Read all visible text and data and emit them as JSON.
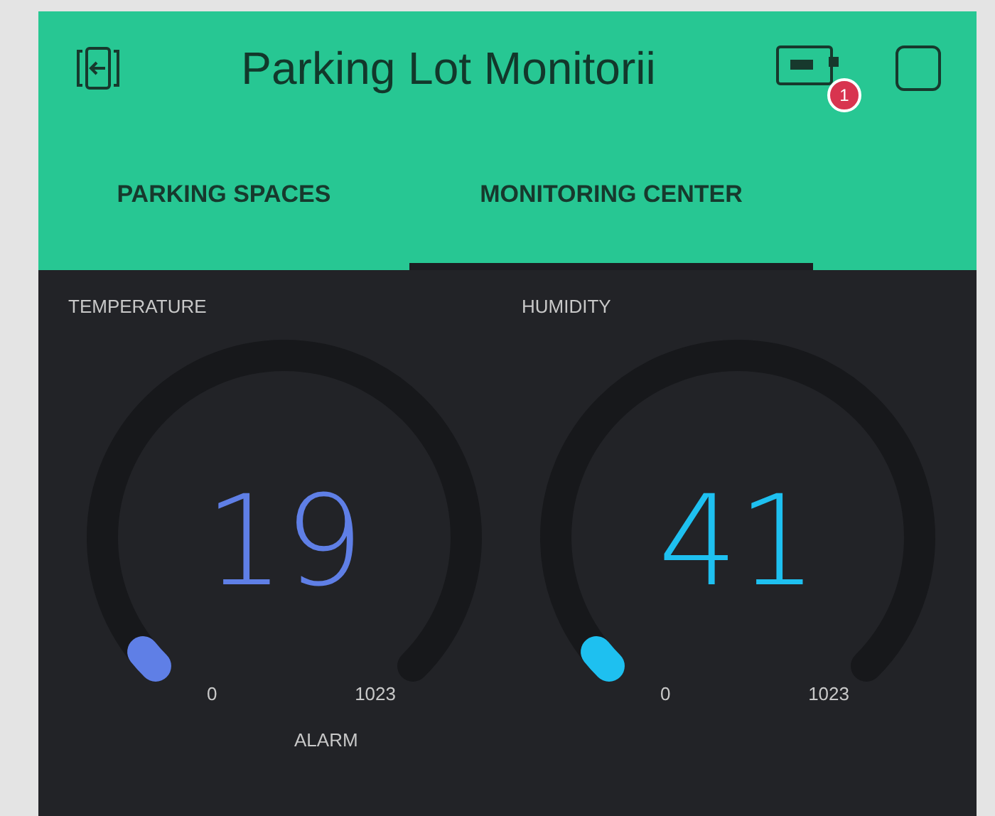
{
  "header": {
    "title": "Parking Lot Monitorii",
    "badge": "1"
  },
  "tabs": [
    {
      "label": "PARKING SPACES",
      "selected": false
    },
    {
      "label": "MONITORING CENTER",
      "selected": true
    }
  ],
  "gauges": [
    {
      "label": "TEMPERATURE",
      "value": "19",
      "min": "0",
      "max": "1023",
      "color": "#5f7fe6"
    },
    {
      "label": "HUMIDITY",
      "value": "41",
      "min": "0",
      "max": "1023",
      "color": "#1ec0f0"
    }
  ],
  "alarm": {
    "label": "ALARM"
  }
}
